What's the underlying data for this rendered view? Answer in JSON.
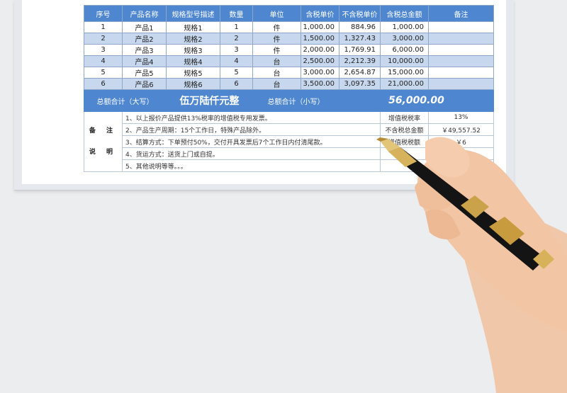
{
  "headers": [
    "序号",
    "产品名称",
    "规格型号描述",
    "数量",
    "单位",
    "含税单价",
    "不含税单价",
    "含税总金额",
    "备注"
  ],
  "rows": [
    {
      "no": "1",
      "name": "产品1",
      "spec": "规格1",
      "qty": "1",
      "unit": "件",
      "price": "1,000.00",
      "price_ex": "884.96",
      "total": "1,000.00",
      "remark": ""
    },
    {
      "no": "2",
      "name": "产品2",
      "spec": "规格2",
      "qty": "2",
      "unit": "件",
      "price": "1,500.00",
      "price_ex": "1,327.43",
      "total": "3,000.00",
      "remark": ""
    },
    {
      "no": "3",
      "name": "产品3",
      "spec": "规格3",
      "qty": "3",
      "unit": "件",
      "price": "2,000.00",
      "price_ex": "1,769.91",
      "total": "6,000.00",
      "remark": ""
    },
    {
      "no": "4",
      "name": "产品4",
      "spec": "规格4",
      "qty": "4",
      "unit": "台",
      "price": "2,500.00",
      "price_ex": "2,212.39",
      "total": "10,000.00",
      "remark": ""
    },
    {
      "no": "5",
      "name": "产品5",
      "spec": "规格5",
      "qty": "5",
      "unit": "台",
      "price": "3,000.00",
      "price_ex": "2,654.87",
      "total": "15,000.00",
      "remark": ""
    },
    {
      "no": "6",
      "name": "产品6",
      "spec": "规格6",
      "qty": "6",
      "unit": "台",
      "price": "3,500.00",
      "price_ex": "3,097.35",
      "total": "21,000.00",
      "remark": ""
    }
  ],
  "total": {
    "upper_label": "总额合计（大写）",
    "upper_value": "伍万陆仟元整",
    "lower_label": "总额合计（小写）",
    "lower_value": "56,000.00"
  },
  "notes": {
    "title_1": "备 注",
    "title_2": "说 明",
    "lines": [
      "1、以上报价产品提供13%税率的增值税专用发票。",
      "2、产品生产周期：15个工作日，特殊产品除外。",
      "3、结算方式：下单预付50%，交付开具发票后7个工作日内付清尾款。",
      "4、货运方式：送货上门或自提。",
      "5、其他说明等等。。。"
    ],
    "tax_rate_label": "增值税税率",
    "tax_rate_value": "13%",
    "ex_tax_label": "不含税总金额",
    "ex_tax_value": "￥49,557.52",
    "tax_label": "增值税税额",
    "tax_value": "￥6"
  },
  "colors": {
    "header": "#4e86cf",
    "stripe": "#c7d8ee"
  }
}
